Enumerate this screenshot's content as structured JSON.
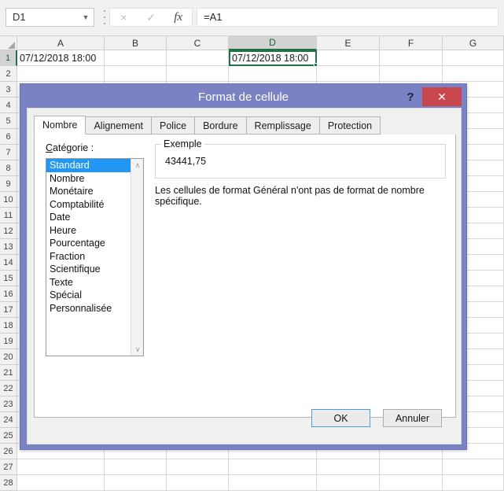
{
  "formula_bar": {
    "name_box_value": "D1",
    "caret_icon": "chevron-down-icon",
    "cancel_icon": "×",
    "confirm_icon": "✓",
    "fx_icon": "fx",
    "formula_value": "=A1"
  },
  "grid": {
    "columns": [
      "A",
      "B",
      "C",
      "D",
      "E",
      "F",
      "G"
    ],
    "selected_column": "D",
    "rows": [
      1,
      2,
      3,
      4,
      5,
      6,
      7,
      8,
      9,
      10,
      11,
      12,
      13,
      14,
      15,
      16,
      17,
      18,
      19,
      20,
      21,
      22,
      23,
      24,
      25,
      26,
      27,
      28
    ],
    "selected_row": 1,
    "cells": {
      "A1": "07/12/2018 18:00",
      "D1": "07/12/2018 18:00"
    },
    "selection_color": "#217346"
  },
  "dialog": {
    "title": "Format de cellule",
    "help_label": "?",
    "close_label": "✕",
    "title_bar_color": "#7b82c4",
    "close_button_color": "#c9474c",
    "tabs": [
      {
        "label": "Nombre",
        "active": true
      },
      {
        "label": "Alignement",
        "active": false
      },
      {
        "label": "Police",
        "active": false
      },
      {
        "label": "Bordure",
        "active": false
      },
      {
        "label": "Remplissage",
        "active": false
      },
      {
        "label": "Protection",
        "active": false
      }
    ],
    "category": {
      "label_prefix": "C",
      "label_rest": "atégorie :",
      "label_full": "Catégorie :",
      "items": [
        "Standard",
        "Nombre",
        "Monétaire",
        "Comptabilité",
        "Date",
        "Heure",
        "Pourcentage",
        "Fraction",
        "Scientifique",
        "Texte",
        "Spécial",
        "Personnalisée"
      ],
      "selected": "Standard",
      "selected_highlight_color": "#2196f3",
      "scroll_up_icon": "∧",
      "scroll_down_icon": "∨"
    },
    "example": {
      "legend": "Exemple",
      "value": "43441,75"
    },
    "description": "Les cellules de format Général n'ont pas de format de nombre spécifique.",
    "buttons": {
      "ok": "OK",
      "cancel": "Annuler"
    }
  }
}
